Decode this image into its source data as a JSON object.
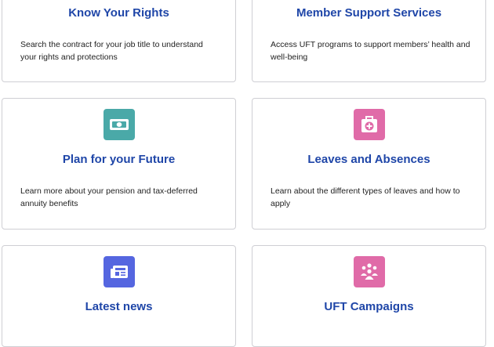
{
  "colors": {
    "title": "#1f46a8",
    "text": "#222222",
    "border": "#cfcfd4",
    "money_tile": "#4aa9a8",
    "medical_tile": "#e06ba8",
    "news_tile": "#5566e0",
    "campaign_tile": "#e06ba8"
  },
  "cards": [
    {
      "title": "Know Your Rights",
      "description": "Search the contract for your job title to understand your rights and protections"
    },
    {
      "title": "Member Support Services",
      "description": "Access UFT programs to support members’ health and well-being"
    },
    {
      "title": "Plan for your Future",
      "icon": "money-icon",
      "description": "Learn more about your pension and tax-deferred annuity benefits"
    },
    {
      "title": "Leaves and Absences",
      "icon": "medical-kit-icon",
      "description": "Learn about the different types of leaves and how to apply"
    },
    {
      "title": "Latest news",
      "icon": "newspaper-icon"
    },
    {
      "title": "UFT Campaigns",
      "icon": "people-group-icon"
    }
  ]
}
